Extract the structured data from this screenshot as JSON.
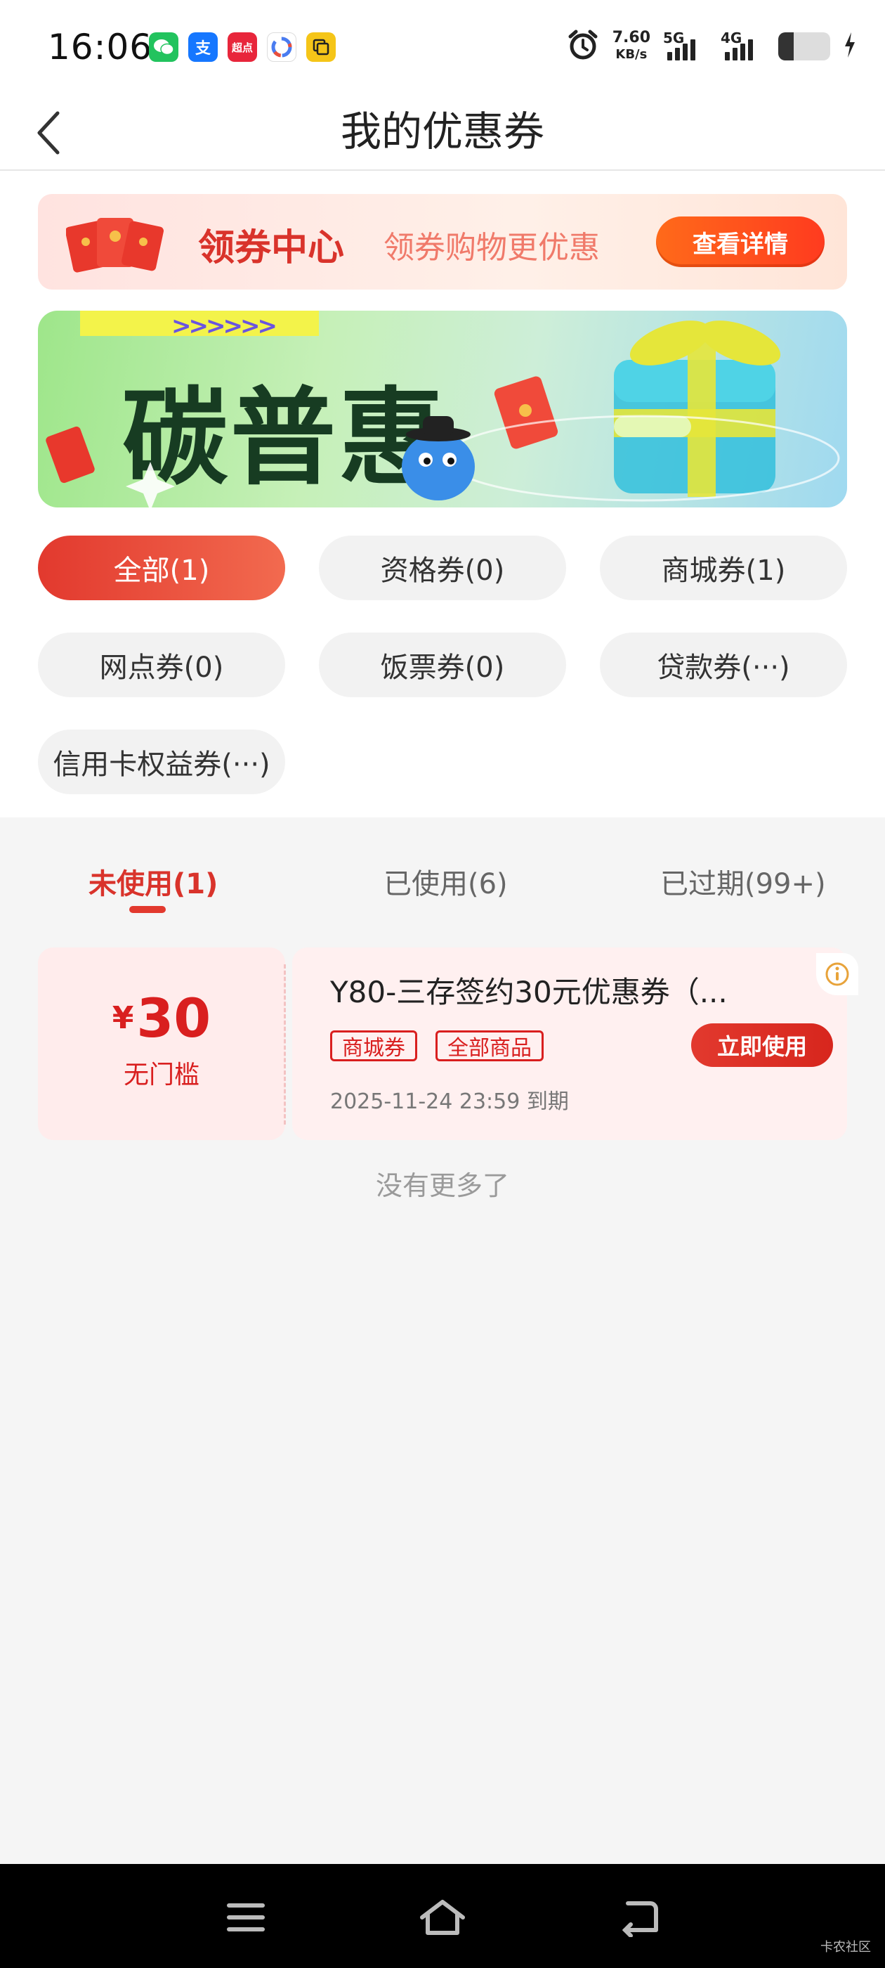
{
  "status_bar": {
    "time": "16:06",
    "speed_value": "7.60",
    "speed_unit": "KB/s",
    "sig1_label": "5G",
    "sig2_label": "4G",
    "app_icons": [
      "wechat-icon",
      "alipay-icon",
      "chaodian-icon",
      "app-icon",
      "copy-icon"
    ],
    "chaodian_label": "超点",
    "alipay_label": "支",
    "battery_level": 0.3
  },
  "nav": {
    "title": "我的优惠券"
  },
  "coupon_center": {
    "title": "领券中心",
    "subtitle": "领券购物更优惠",
    "button": "查看详情"
  },
  "promo_banner": {
    "text": "碳普惠",
    "arrows": ">>>>>>"
  },
  "filters": [
    {
      "label": "全部(1)",
      "active": true
    },
    {
      "label": "资格券(0)",
      "active": false
    },
    {
      "label": "商城券(1)",
      "active": false
    },
    {
      "label": "网点券(0)",
      "active": false
    },
    {
      "label": "饭票券(0)",
      "active": false
    },
    {
      "label": "贷款券(···)",
      "active": false
    },
    {
      "label": "信用卡权益券(···)",
      "active": false
    }
  ],
  "tabs": [
    {
      "label": "未使用(1)",
      "active": true
    },
    {
      "label": "已使用(6)",
      "active": false
    },
    {
      "label": "已过期(99+)",
      "active": false
    }
  ],
  "coupon": {
    "currency": "¥",
    "amount": "30",
    "threshold": "无门槛",
    "title": "Y80-三存签约30元优惠券（...",
    "tags": [
      "商城券",
      "全部商品"
    ],
    "button": "立即使用",
    "expiry": "2025-11-24 23:59 到期"
  },
  "list_footer": "没有更多了",
  "watermark": "卡农社区",
  "colors": {
    "brand_red": "#e2392e",
    "accent_orange": "#ff6a1a"
  }
}
